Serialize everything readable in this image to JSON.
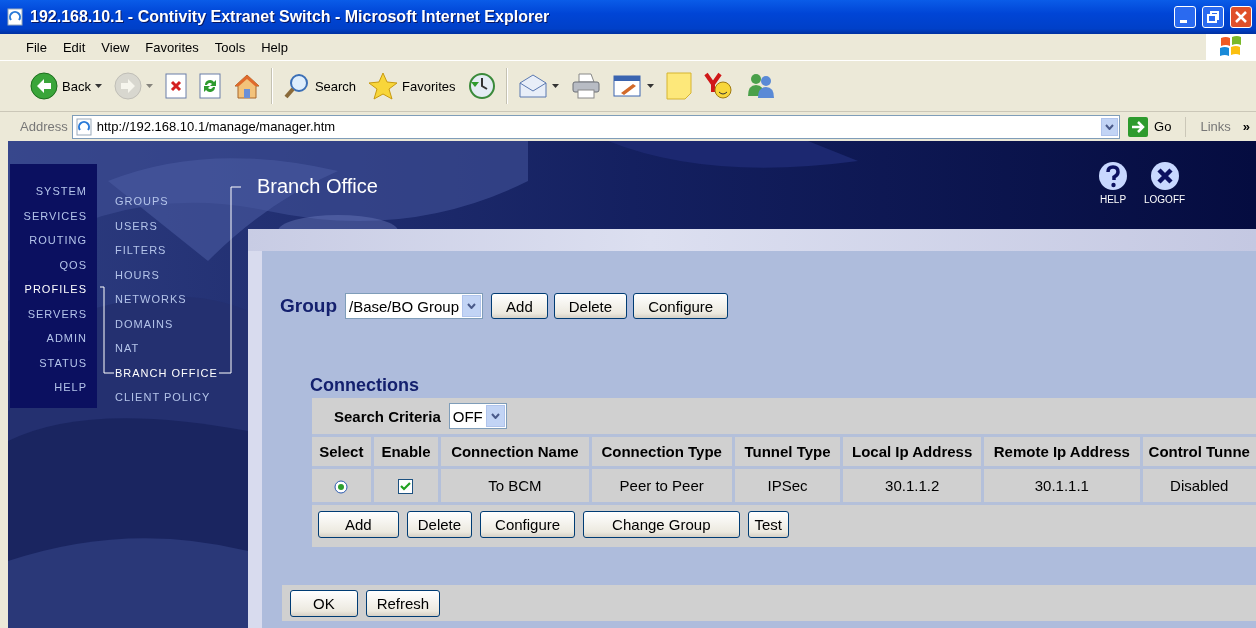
{
  "window": {
    "title": "192.168.10.1 - Contivity Extranet Switch - Microsoft Internet Explorer"
  },
  "menu": [
    "File",
    "Edit",
    "View",
    "Favorites",
    "Tools",
    "Help"
  ],
  "toolbar": [
    [
      {
        "kind": "back",
        "label": "Back",
        "menu": true,
        "disabled": false
      },
      {
        "kind": "forward",
        "menu": true,
        "disabled": true
      },
      {
        "kind": "stop",
        "menu": false,
        "disabled": false
      },
      {
        "kind": "refresh",
        "menu": false,
        "disabled": false
      },
      {
        "kind": "home",
        "menu": false,
        "disabled": false
      }
    ],
    [
      {
        "kind": "search",
        "label": "Search",
        "menu": false,
        "disabled": false
      },
      {
        "kind": "favorites",
        "label": "Favorites",
        "menu": false,
        "disabled": false
      },
      {
        "kind": "history",
        "menu": false,
        "disabled": false
      }
    ],
    [
      {
        "kind": "mail",
        "menu": true,
        "disabled": false
      },
      {
        "kind": "print",
        "menu": false,
        "disabled": false
      },
      {
        "kind": "edit",
        "menu": true,
        "disabled": false
      },
      {
        "kind": "notes",
        "menu": false,
        "disabled": false
      },
      {
        "kind": "yahoo",
        "menu": false,
        "disabled": false
      },
      {
        "kind": "messenger",
        "menu": false,
        "disabled": false
      }
    ]
  ],
  "address": {
    "label": "Address",
    "value": "http://192.168.10.1/manage/manager.htm",
    "go": "Go",
    "links": "Links",
    "more": "»"
  },
  "nav": {
    "main": [
      {
        "label": "SYSTEM",
        "selected": false
      },
      {
        "label": "SERVICES",
        "selected": false
      },
      {
        "label": "ROUTING",
        "selected": false
      },
      {
        "label": "QOS",
        "selected": false
      },
      {
        "label": "PROFILES",
        "selected": true
      },
      {
        "label": "SERVERS",
        "selected": false
      },
      {
        "label": "ADMIN",
        "selected": false
      },
      {
        "label": "STATUS",
        "selected": false
      },
      {
        "label": "HELP",
        "selected": false
      }
    ],
    "sub": [
      {
        "label": "GROUPS",
        "selected": false
      },
      {
        "label": "USERS",
        "selected": false
      },
      {
        "label": "FILTERS",
        "selected": false
      },
      {
        "label": "HOURS",
        "selected": false
      },
      {
        "label": "NETWORKS",
        "selected": false
      },
      {
        "label": "DOMAINS",
        "selected": false
      },
      {
        "label": "NAT",
        "selected": false
      },
      {
        "label": "BRANCH OFFICE",
        "selected": true
      },
      {
        "label": "CLIENT POLICY",
        "selected": false
      }
    ]
  },
  "page_title": "Branch Office",
  "header_actions": [
    {
      "kind": "help",
      "label": "HELP"
    },
    {
      "kind": "logoff",
      "label": "LOGOFF"
    }
  ],
  "group": {
    "label": "Group",
    "value": "/Base/BO Group",
    "buttons": [
      "Add",
      "Delete",
      "Configure"
    ]
  },
  "connections": {
    "title": "Connections",
    "search_label": "Search Criteria",
    "search_value": "OFF",
    "columns": [
      "Select",
      "Enable",
      "Connection Name",
      "Connection Type",
      "Tunnel Type",
      "Local Ip Address",
      "Remote Ip Address",
      "Control Tunne"
    ],
    "rows": [
      {
        "selected": true,
        "enabled": true,
        "connection_name": "To BCM",
        "connection_type": "Peer to Peer",
        "tunnel_type": "IPSec",
        "local_ip_address": "30.1.1.2",
        "remote_ip_address": "30.1.1.1",
        "control_tunnel": "Disabled"
      }
    ],
    "buttons": [
      "Add",
      "Delete",
      "Configure",
      "Change Group",
      "Test"
    ]
  },
  "footer_buttons": [
    "OK",
    "Refresh"
  ]
}
